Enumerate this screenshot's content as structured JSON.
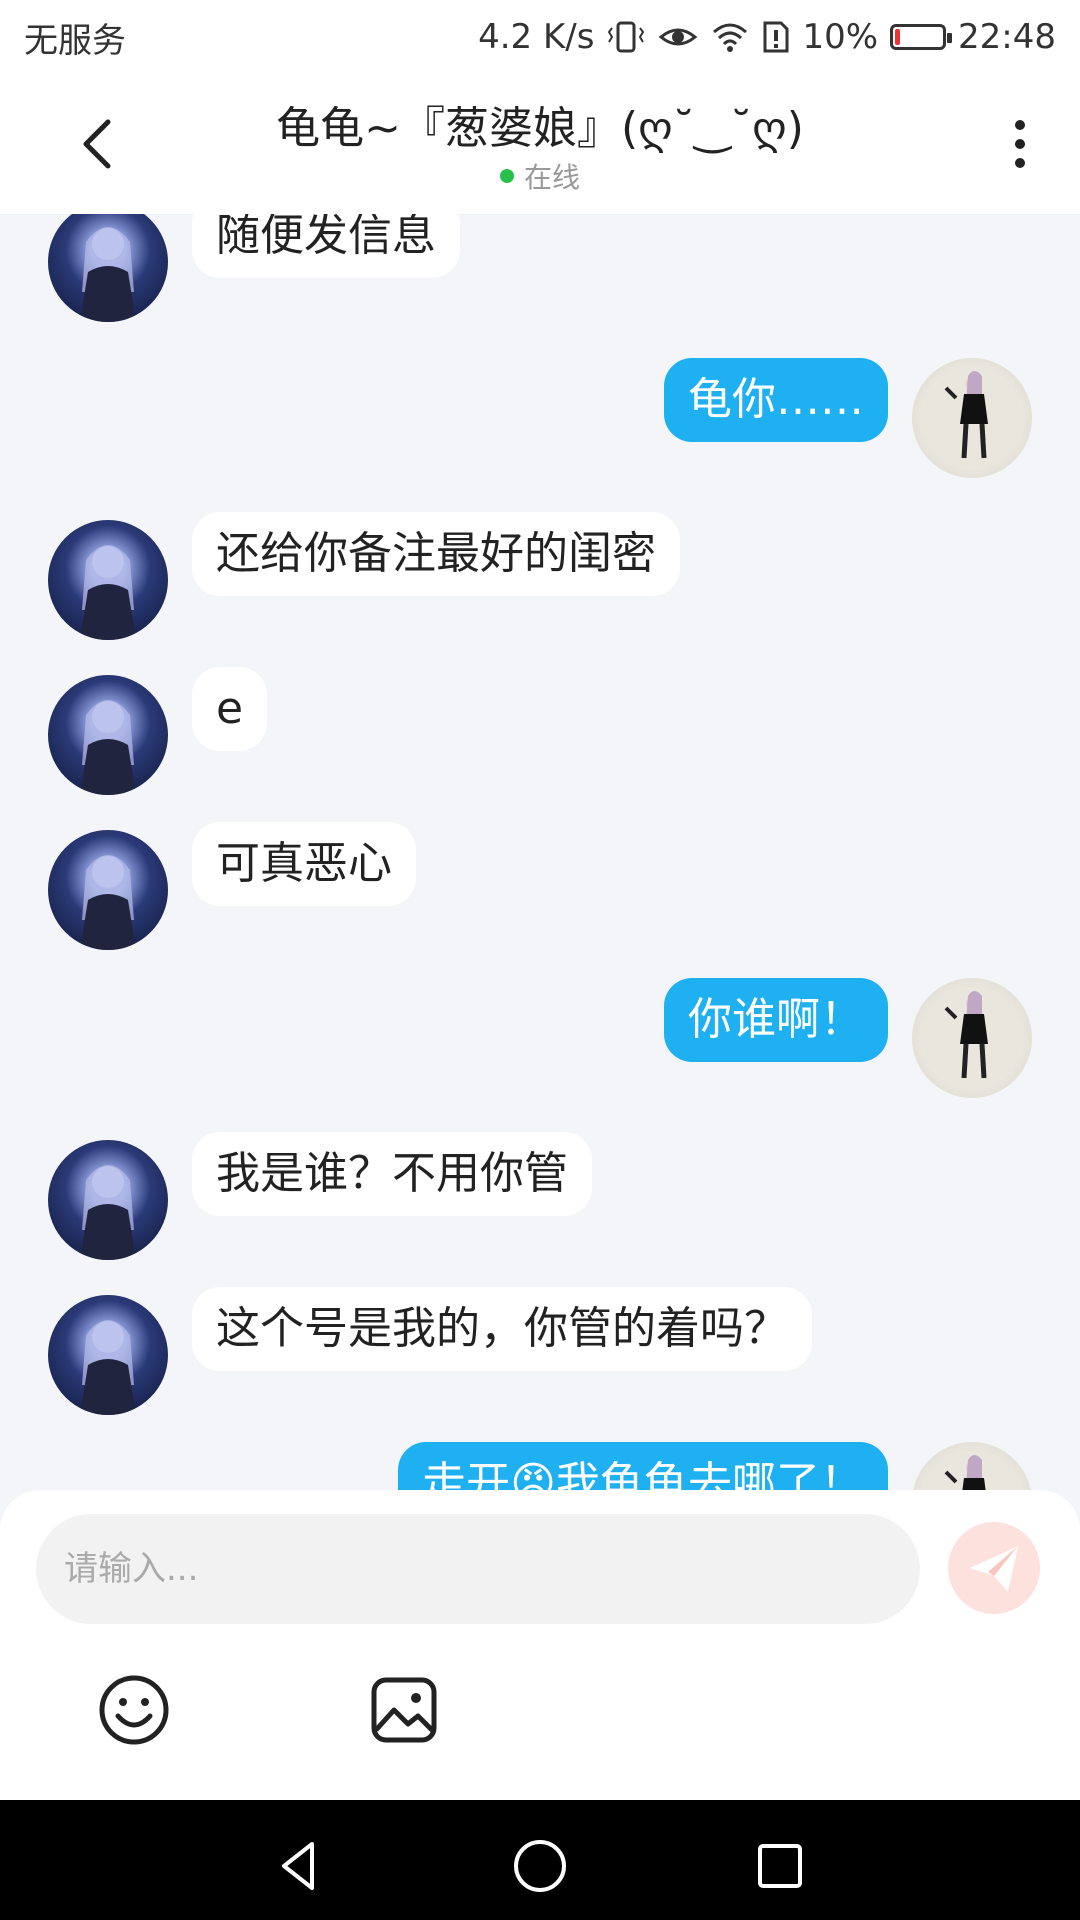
{
  "status_bar": {
    "carrier": "无服务",
    "net_speed": "4.2 K/s",
    "battery_percent": "10%",
    "battery_level": 0.1,
    "time": "22:48"
  },
  "header": {
    "title": "龟龟~『葱婆娘』(ღ˘‿˘ღ)",
    "status": "在线",
    "status_color": "#27c04b"
  },
  "messages": [
    {
      "from": "them",
      "text": "随便发信息"
    },
    {
      "from": "me",
      "text": "龟你……"
    },
    {
      "from": "them",
      "text": "还给你备注最好的闺密"
    },
    {
      "from": "them",
      "text": "e"
    },
    {
      "from": "them",
      "text": "可真恶心"
    },
    {
      "from": "me",
      "text": "你谁啊！"
    },
    {
      "from": "them",
      "text": "我是谁？不用你管"
    },
    {
      "from": "them",
      "text": "这个号是我的，你管的着吗？"
    },
    {
      "from": "me",
      "text": "走开😡我龟龟去哪了！"
    }
  ],
  "composer": {
    "placeholder": "请输入...",
    "send_icon": "send-icon",
    "tools": [
      "emoji-icon",
      "image-icon"
    ]
  },
  "colors": {
    "accent": "#1fb0f2",
    "background": "#f3f5f8",
    "send_disabled": "#fde1dc"
  }
}
